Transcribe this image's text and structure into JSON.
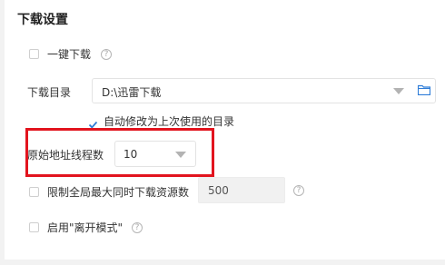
{
  "section": {
    "title": "下载设置"
  },
  "one_click": {
    "label": "一键下载",
    "checked": false
  },
  "download_dir": {
    "label": "下载目录",
    "value": "D:\\迅雷下载",
    "auto_modify_label": "自动修改为上次使用的目录",
    "auto_modify_checked": true
  },
  "threads": {
    "label": "原始地址线程数",
    "value": "10"
  },
  "limit_resources": {
    "label": "限制全局最大同时下载资源数",
    "value": "500",
    "checked": false
  },
  "away_mode": {
    "label": "启用\"离开模式\"",
    "checked": false
  },
  "colors": {
    "highlight": "#e2141e",
    "accent": "#2f7dd8"
  },
  "icons": {
    "help": "help-icon",
    "folder": "folder-icon",
    "dropdown": "chevron-down-icon",
    "check": "check-icon"
  }
}
